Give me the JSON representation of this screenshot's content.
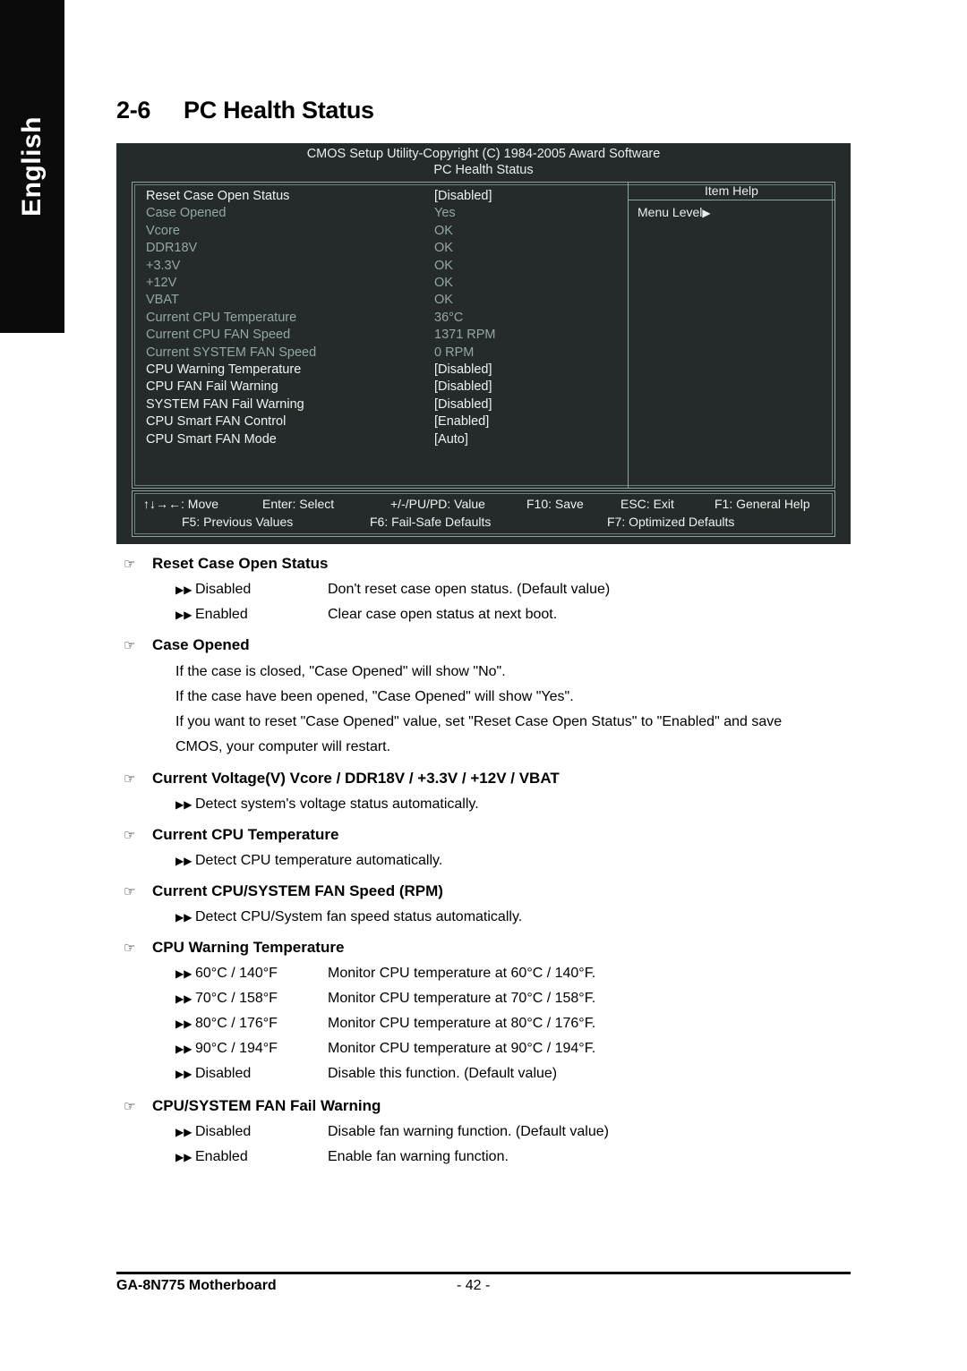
{
  "sidebar": {
    "language_tab": "English"
  },
  "heading": {
    "number": "2-6",
    "title": "PC Health Status"
  },
  "bios": {
    "title_line1": "CMOS Setup Utility-Copyright (C) 1984-2005 Award Software",
    "title_line2": "PC Health Status",
    "item_help_header": "Item Help",
    "menu_level": "Menu Level",
    "menu_level_arrow": "▶",
    "rows": [
      {
        "name": "Reset Case Open Status",
        "value": "[Disabled]",
        "state": "bright"
      },
      {
        "name": "Case Opened",
        "value": "Yes",
        "state": "dim"
      },
      {
        "name": "Vcore",
        "value": "OK",
        "state": "dim"
      },
      {
        "name": "DDR18V",
        "value": "OK",
        "state": "dim"
      },
      {
        "name": "+3.3V",
        "value": "OK",
        "state": "dim"
      },
      {
        "name": "+12V",
        "value": "OK",
        "state": "dim"
      },
      {
        "name": "VBAT",
        "value": "OK",
        "state": "dim"
      },
      {
        "name": "Current CPU Temperature",
        "value": "36°C",
        "state": "dim"
      },
      {
        "name": "Current CPU FAN Speed",
        "value": "1371 RPM",
        "state": "dim"
      },
      {
        "name": "Current SYSTEM FAN Speed",
        "value": "0     RPM",
        "state": "dim"
      },
      {
        "name": "CPU Warning Temperature",
        "value": "[Disabled]",
        "state": "bright"
      },
      {
        "name": "CPU FAN Fail Warning",
        "value": "[Disabled]",
        "state": "bright"
      },
      {
        "name": "SYSTEM FAN Fail Warning",
        "value": "[Disabled]",
        "state": "bright"
      },
      {
        "name": "CPU Smart FAN Control",
        "value": "[Enabled]",
        "state": "bright"
      },
      {
        "name": "CPU Smart FAN Mode",
        "value": "[Auto]",
        "state": "bright"
      }
    ],
    "footer": {
      "move": "↑↓→←: Move",
      "select": "Enter: Select",
      "value": "+/-/PU/PD: Value",
      "save": "F10: Save",
      "exit": "ESC: Exit",
      "general_help": "F1: General Help",
      "previous_values": "F5: Previous Values",
      "fail_safe": "F6: Fail-Safe Defaults",
      "optimized": "F7: Optimized Defaults"
    }
  },
  "sections": {
    "reset_case_open_status": {
      "title": "Reset Case Open Status",
      "options": [
        {
          "label": "Disabled",
          "desc": "Don't reset case open status. (Default value)"
        },
        {
          "label": "Enabled",
          "desc": "Clear case open status at next boot."
        }
      ]
    },
    "case_opened": {
      "title": "Case Opened",
      "paragraphs": [
        "If the case is closed, \"Case Opened\" will show \"No\".",
        "If the case have been opened, \"Case Opened\" will show \"Yes\".",
        "If you want to reset \"Case Opened\" value, set \"Reset Case Open Status\" to \"Enabled\" and save",
        "CMOS, your computer will restart."
      ]
    },
    "current_voltage": {
      "title": "Current Voltage(V) Vcore / DDR18V / +3.3V / +12V / VBAT",
      "options": [
        {
          "label": "",
          "desc": "Detect system's voltage status automatically."
        }
      ]
    },
    "current_cpu_temperature": {
      "title": "Current CPU Temperature",
      "options": [
        {
          "label": "",
          "desc": "Detect CPU temperature automatically."
        }
      ]
    },
    "current_fan_speed": {
      "title": "Current CPU/SYSTEM FAN Speed (RPM)",
      "options": [
        {
          "label": "",
          "desc": "Detect CPU/System fan speed status automatically."
        }
      ]
    },
    "cpu_warning_temperature": {
      "title": "CPU Warning Temperature",
      "options": [
        {
          "label": "60°C / 140°F",
          "desc": "Monitor CPU temperature at 60°C / 140°F."
        },
        {
          "label": "70°C / 158°F",
          "desc": "Monitor CPU temperature at 70°C / 158°F."
        },
        {
          "label": "80°C / 176°F",
          "desc": "Monitor CPU temperature at 80°C / 176°F."
        },
        {
          "label": "90°C / 194°F",
          "desc": "Monitor CPU temperature at 90°C / 194°F."
        },
        {
          "label": "Disabled",
          "desc": "Disable this function. (Default value)"
        }
      ]
    },
    "fan_fail_warning": {
      "title": "CPU/SYSTEM FAN Fail Warning",
      "options": [
        {
          "label": "Disabled",
          "desc": "Disable fan warning function. (Default value)"
        },
        {
          "label": "Enabled",
          "desc": "Enable fan warning function."
        }
      ]
    }
  },
  "page_footer": {
    "product": "GA-8N775 Motherboard",
    "page_number": "- 42 -"
  },
  "glyphs": {
    "hand": "☞",
    "bullet": "▶▶"
  }
}
